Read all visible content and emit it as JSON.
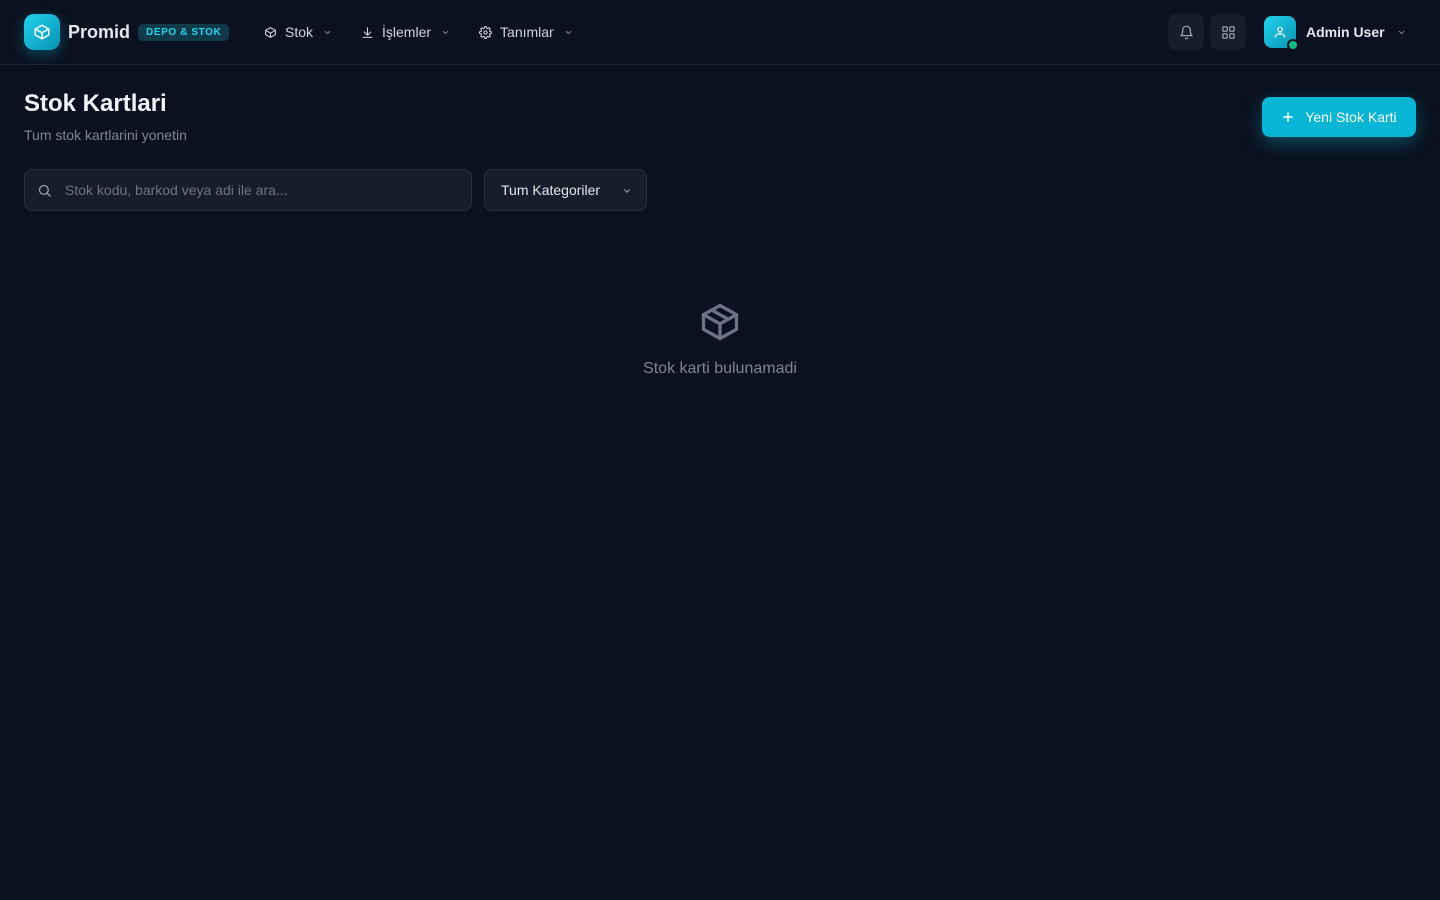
{
  "brand": {
    "name": "Promid",
    "badge": "DEPO & STOK"
  },
  "nav": {
    "items": [
      {
        "label": "Stok",
        "icon": "box-icon"
      },
      {
        "label": "İşlemler",
        "icon": "download-icon"
      },
      {
        "label": "Tanımlar",
        "icon": "gear-icon"
      }
    ]
  },
  "header_actions": {
    "notifications_icon": "bell-icon",
    "apps_icon": "grid-icon"
  },
  "user": {
    "name": "Admin User",
    "status": "online"
  },
  "page": {
    "title": "Stok Kartlari",
    "subtitle": "Tum stok kartlarini yonetin",
    "new_button_label": "Yeni Stok Karti"
  },
  "filters": {
    "search_placeholder": "Stok kodu, barkod veya adi ile ara...",
    "search_value": "",
    "category_selected": "Tum Kategoriler"
  },
  "empty_state": {
    "icon": "package-icon",
    "message": "Stok karti bulunamadi"
  },
  "colors": {
    "background": "#0b1120",
    "accent": "#06b6d4",
    "online": "#10b981"
  }
}
